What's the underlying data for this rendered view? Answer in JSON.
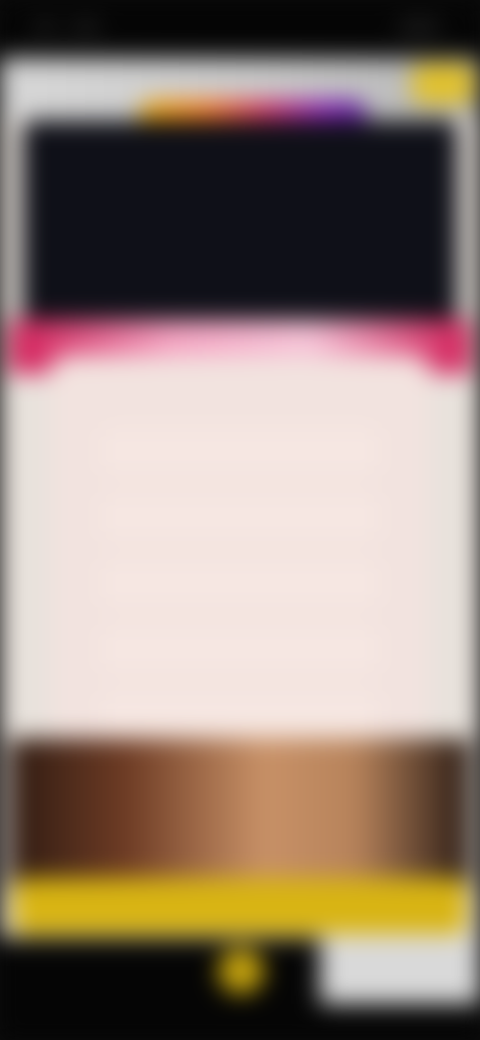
{
  "hero": {
    "title": ""
  },
  "pink_band": {
    "label": ""
  },
  "options": [
    {
      "label": ""
    },
    {
      "label": ""
    },
    {
      "label": ""
    },
    {
      "label": ""
    },
    {
      "label": ""
    }
  ],
  "cta": {
    "label": ""
  },
  "colors": {
    "accent_yellow": "#d8b413",
    "accent_pink": "#d01a55",
    "hero_background": "#0f1018"
  },
  "icons": {
    "bottom_nav_center": "play-icon"
  }
}
